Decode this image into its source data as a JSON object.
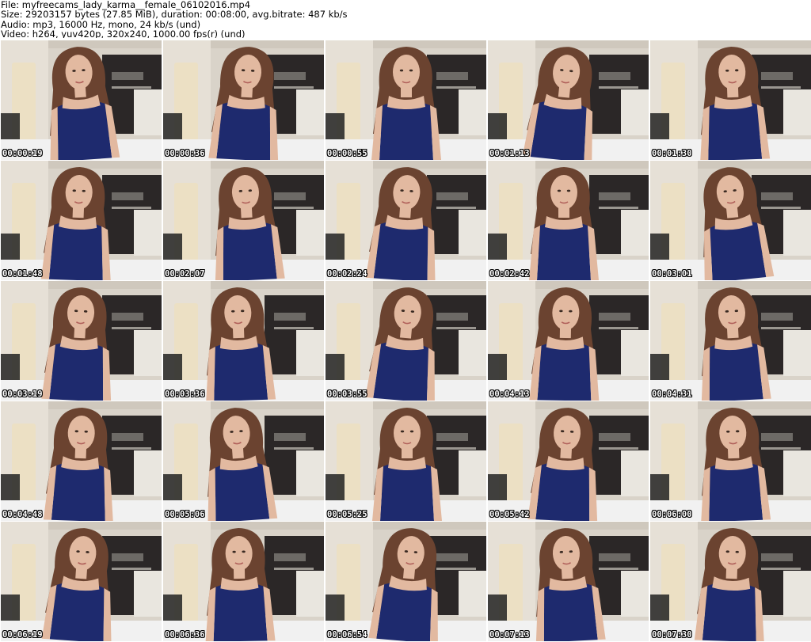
{
  "header": {
    "file": "File: myfreecams_lady_karma__female_06102016.mp4",
    "size": "Size: 29203157 bytes (27.85 MiB), duration: 00:08:00, avg.bitrate: 487 kb/s",
    "audio": "Audio: mp3, 16000 Hz, mono, 24 kb/s (und)",
    "video": "Video: h264, yuv420p, 320x240, 1000.00 fps(r) (und)"
  },
  "frames": [
    {
      "timestamp": "00:00:19"
    },
    {
      "timestamp": "00:00:36"
    },
    {
      "timestamp": "00:00:55"
    },
    {
      "timestamp": "00:01:13"
    },
    {
      "timestamp": "00:01:30"
    },
    {
      "timestamp": "00:01:48"
    },
    {
      "timestamp": "00:02:07"
    },
    {
      "timestamp": "00:02:24"
    },
    {
      "timestamp": "00:02:42"
    },
    {
      "timestamp": "00:03:01"
    },
    {
      "timestamp": "00:03:19"
    },
    {
      "timestamp": "00:03:36"
    },
    {
      "timestamp": "00:03:55"
    },
    {
      "timestamp": "00:04:13"
    },
    {
      "timestamp": "00:04:31"
    },
    {
      "timestamp": "00:04:48"
    },
    {
      "timestamp": "00:05:06"
    },
    {
      "timestamp": "00:05:25"
    },
    {
      "timestamp": "00:05:42"
    },
    {
      "timestamp": "00:06:00"
    },
    {
      "timestamp": "00:06:19"
    },
    {
      "timestamp": "00:06:36"
    },
    {
      "timestamp": "00:06:54"
    },
    {
      "timestamp": "00:07:13"
    },
    {
      "timestamp": "00:07:30"
    }
  ],
  "colors": {
    "wall": "#d9d3c9",
    "door": "#ece0c4",
    "cabinet": "#2b2727",
    "hair": "#6b4330",
    "skin": "#e2b9a0",
    "dress": "#1e2a6e",
    "bed": "#f1f1f1",
    "stamp_text": "#ffffff",
    "stamp_outline": "#000000"
  }
}
